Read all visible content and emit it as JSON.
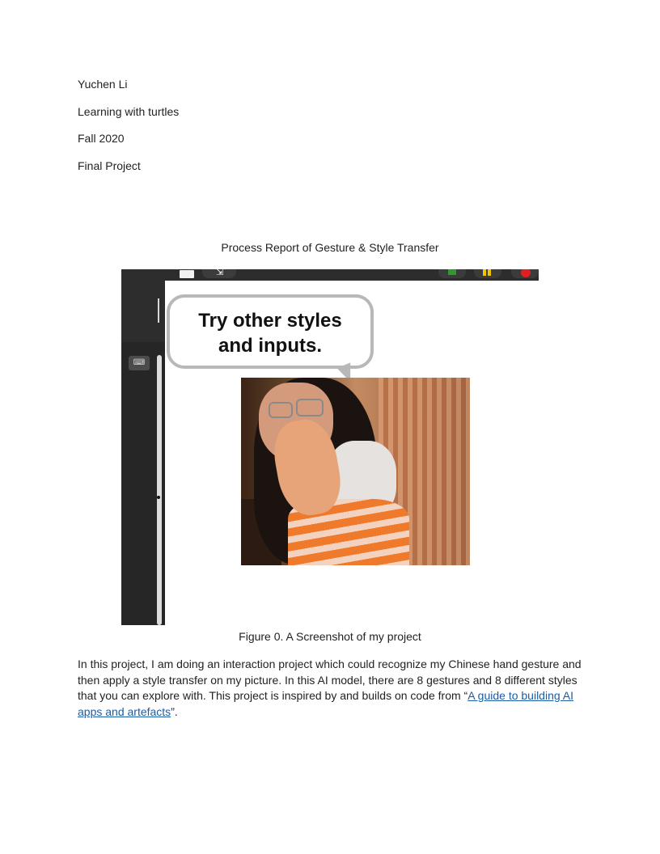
{
  "header": {
    "author": "Yuchen Li",
    "course": "Learning with turtles",
    "term": "Fall 2020",
    "assignment": "Final Project"
  },
  "title": "Process Report of Gesture & Style Transfer",
  "figure": {
    "bubble_line1": "Try other styles",
    "bubble_line2": "and inputs.",
    "caption": "Figure 0. A Screenshot of my project"
  },
  "body": {
    "text": "In this project, I am doing an interaction project which could recognize my Chinese hand gesture and then apply a style transfer on my picture. In this AI model, there are 8 gestures and 8 different styles that you can explore with. This project is inspired by and builds on code from “",
    "link_text": "A guide to building AI apps and artefacts",
    "tail": "”."
  },
  "colors": {
    "link": "#1a5da6",
    "flag": "#2e9a2e",
    "pause": "#f4c400",
    "stop": "#e02020"
  },
  "icons": [
    "keyboard-icon",
    "fullscreen-arrow-icon",
    "green-flag-icon",
    "pause-icon",
    "stop-icon"
  ]
}
